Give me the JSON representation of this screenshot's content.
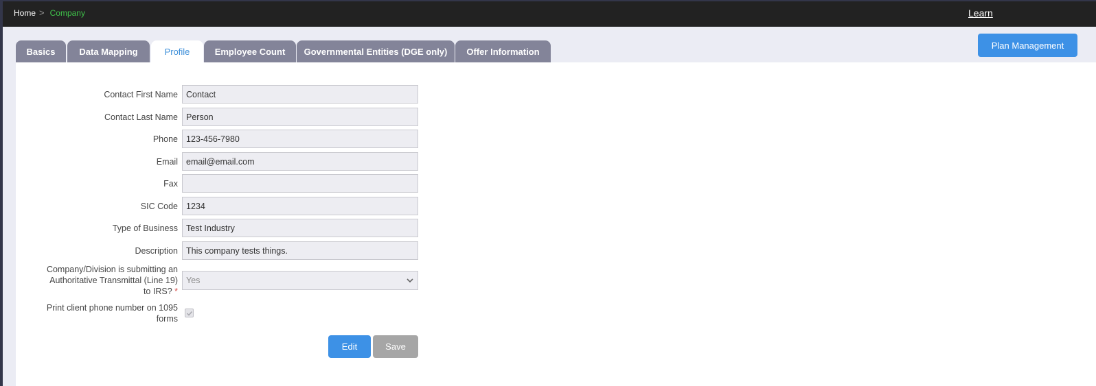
{
  "breadcrumb": {
    "home": "Home",
    "separator": ">",
    "current": "Company"
  },
  "header": {
    "learn": "Learn"
  },
  "plan_management": "Plan Management",
  "tabs": [
    {
      "label": "Basics"
    },
    {
      "label": "Data Mapping"
    },
    {
      "label": "Profile"
    },
    {
      "label": "Employee Count"
    },
    {
      "label": "Governmental Entities (DGE only)"
    },
    {
      "label": "Offer Information"
    }
  ],
  "form": {
    "fields": [
      {
        "label": "Contact First Name",
        "value": "Contact"
      },
      {
        "label": "Contact Last Name",
        "value": "Person"
      },
      {
        "label": "Phone",
        "value": "123-456-7980"
      },
      {
        "label": "Email",
        "value": "email@email.com"
      },
      {
        "label": "Fax",
        "value": ""
      },
      {
        "label": "SIC Code",
        "value": "1234"
      },
      {
        "label": "Type of Business",
        "value": "Test Industry"
      },
      {
        "label": "Description",
        "value": "This company tests things."
      }
    ],
    "transmittal": {
      "label_line1": "Company/Division is submitting an",
      "label_line2": "Authoritative Transmittal (Line 19)",
      "label_line3": "to IRS?",
      "required_mark": "*",
      "value": "Yes"
    },
    "print_phone": {
      "label_line1": "Print client phone number on 1095",
      "label_line2": "forms",
      "checked": true
    },
    "edit_label": "Edit",
    "save_label": "Save"
  },
  "colors": {
    "accent": "#3d91e6",
    "topbar": "#222222",
    "breadcrumb_current": "#3fc14a",
    "tab_inactive": "#838499",
    "tab_active_text": "#3d8fd9"
  }
}
